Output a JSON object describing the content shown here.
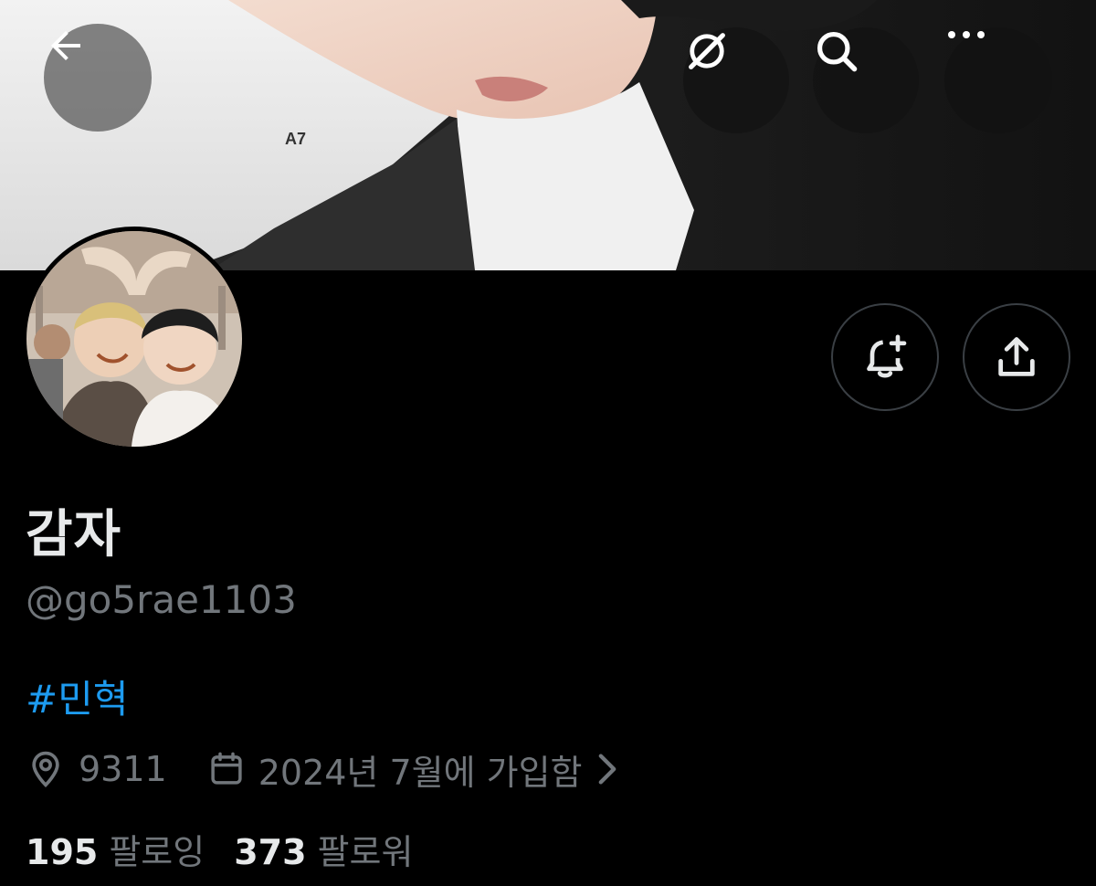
{
  "profile": {
    "display_name": "감자",
    "handle": "@go5rae1103",
    "bio": "#민혁",
    "location": "9311",
    "joined": "2024년 7월에 가입함"
  },
  "stats": {
    "following_count": "195",
    "following_label": "팔로잉",
    "followers_count": "373",
    "followers_label": "팔로워"
  },
  "icons": {
    "back": "arrow-left-icon",
    "grok": "grok-icon",
    "search": "search-icon",
    "more": "more-dots-icon",
    "notify": "bell-plus-icon",
    "share": "share-icon",
    "location": "location-pin-icon",
    "calendar": "calendar-icon",
    "chevron": "chevron-right-icon"
  },
  "colors": {
    "background": "#000000",
    "text_primary": "#e7e9ea",
    "text_secondary": "#71767b",
    "accent": "#1d9bf0",
    "button_border": "#3a3f44"
  }
}
